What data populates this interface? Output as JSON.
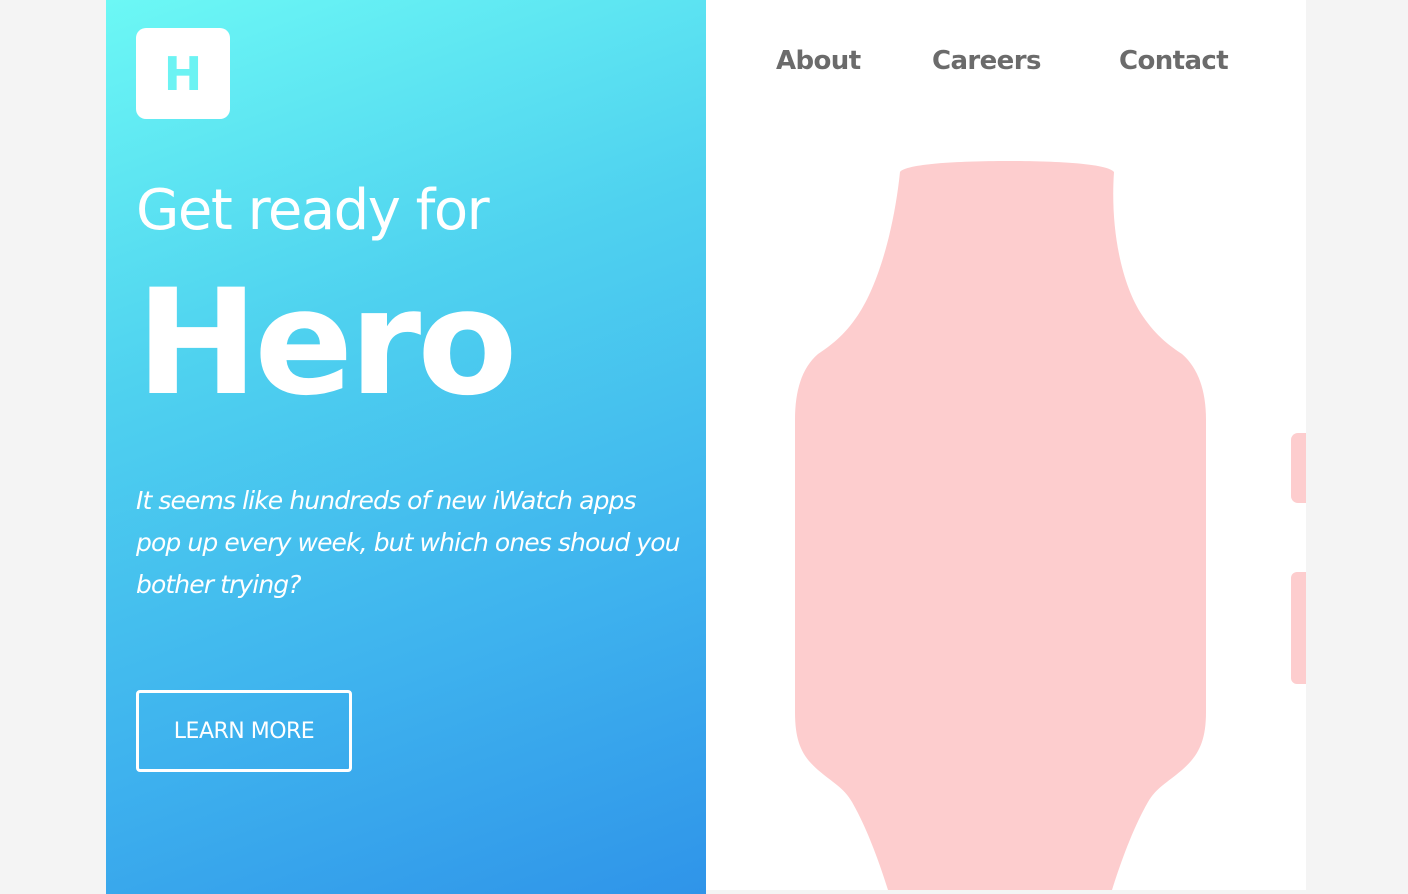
{
  "logo": {
    "letter": "H"
  },
  "hero": {
    "tagline": "Get ready for",
    "headline": "Hero",
    "description": "It seems like hundreds of new iWatch apps pop up every week, but which ones shoud you bother trying?",
    "cta_label": "LEARN MORE"
  },
  "nav": {
    "items": [
      {
        "label": "About"
      },
      {
        "label": "Careers"
      },
      {
        "label": "Contact"
      }
    ]
  },
  "colors": {
    "gradient_start": "#6cf8f5",
    "gradient_end": "#2f94e9",
    "watch_fill": "#fdcdce",
    "nav_text": "#6b6b6b",
    "page_background": "#f4f4f4"
  },
  "icons": {
    "logo": "letter-h-logo-icon",
    "watch": "smartwatch-silhouette-icon"
  }
}
